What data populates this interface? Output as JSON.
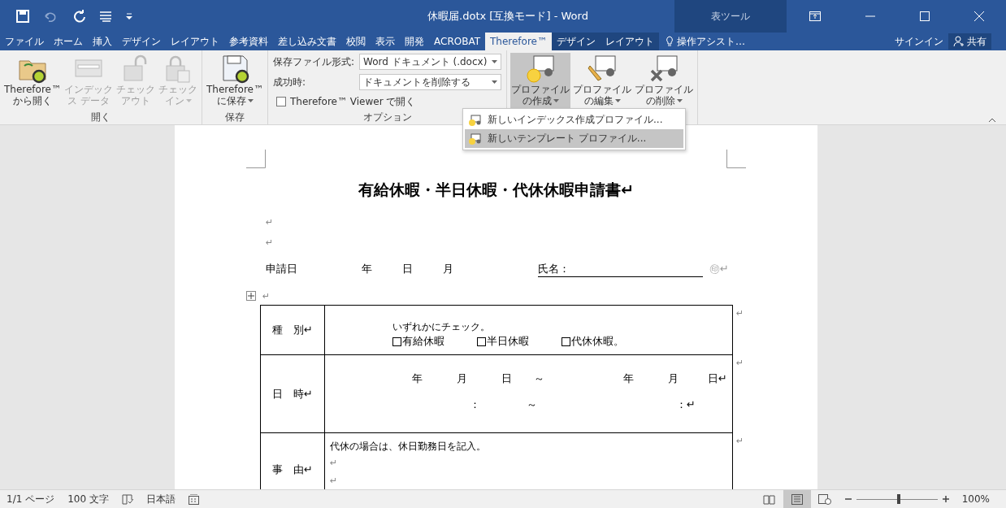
{
  "title_bar": {
    "title": "休暇届.dotx [互換モード] - Word",
    "context_label": "表ツール"
  },
  "tabs": [
    {
      "label": "ファイル",
      "selected": false,
      "kind": "main"
    },
    {
      "label": "ホーム",
      "selected": false,
      "kind": "main"
    },
    {
      "label": "挿入",
      "selected": false,
      "kind": "main"
    },
    {
      "label": "デザイン",
      "selected": false,
      "kind": "main"
    },
    {
      "label": "レイアウト",
      "selected": false,
      "kind": "main"
    },
    {
      "label": "参考資料",
      "selected": false,
      "kind": "main"
    },
    {
      "label": "差し込み文書",
      "selected": false,
      "kind": "main"
    },
    {
      "label": "校閲",
      "selected": false,
      "kind": "main"
    },
    {
      "label": "表示",
      "selected": false,
      "kind": "main"
    },
    {
      "label": "開発",
      "selected": false,
      "kind": "main"
    },
    {
      "label": "ACROBAT",
      "selected": false,
      "kind": "main"
    },
    {
      "label": "Therefore™",
      "selected": true,
      "kind": "main"
    },
    {
      "label": "デザイン",
      "selected": false,
      "kind": "context"
    },
    {
      "label": "レイアウト",
      "selected": false,
      "kind": "context"
    }
  ],
  "tell_me": "操作アシスト…",
  "sign_in": "サインイン",
  "share": "共有",
  "ribbon": {
    "groups": [
      {
        "label": "開く",
        "buttons": [
          {
            "lines": [
              "Therefore™",
              "から開く"
            ],
            "disabled": false,
            "dropdown": false
          },
          {
            "lines": [
              "インデック",
              "ス データ"
            ],
            "disabled": true,
            "dropdown": false
          },
          {
            "lines": [
              "チェック",
              "アウト"
            ],
            "disabled": true,
            "dropdown": false
          },
          {
            "lines": [
              "チェック",
              "イン"
            ],
            "disabled": true,
            "dropdown": true
          }
        ]
      },
      {
        "label": "保存",
        "buttons": [
          {
            "lines": [
              "Therefore™",
              "に保存"
            ],
            "disabled": false,
            "dropdown": true
          }
        ]
      },
      {
        "label": "オプション",
        "options": {
          "format_label": "保存ファイル形式:",
          "format_value": "Word ドキュメント (.docx)",
          "success_label": "成功時:",
          "success_value": "ドキュメントを削除する",
          "viewer_label": "Therefore™ Viewer で開く",
          "viewer_checked": false
        }
      },
      {
        "buttons": [
          {
            "lines": [
              "プロファイル",
              "の作成"
            ],
            "disabled": false,
            "dropdown": true,
            "selected": true
          },
          {
            "lines": [
              "プロファイル",
              "の編集"
            ],
            "disabled": false,
            "dropdown": true,
            "selected": false
          },
          {
            "lines": [
              "プロファイル",
              "の削除"
            ],
            "disabled": false,
            "dropdown": true,
            "selected": false
          }
        ]
      }
    ]
  },
  "menu": {
    "items": [
      {
        "label": "新しいインデックス作成プロファイル...",
        "selected": false
      },
      {
        "label": "新しいテンプレート プロファイル...",
        "selected": true
      }
    ]
  },
  "document": {
    "title": "有給休暇・半日休暇・代休休暇申請書↵",
    "blank_marks": [
      "↵",
      "↵"
    ],
    "apply_line": {
      "label": "申請日",
      "date_parts": [
        "年",
        "日",
        "月"
      ],
      "name_label": "氏名：",
      "seal": "㊞↵"
    },
    "pre_table_mark": "↵",
    "rows": [
      {
        "header": "種　別↵",
        "end_mark": "↵",
        "kind": "check",
        "note": "いずれかにチェック。",
        "options": [
          {
            "label": "有給休暇",
            "checked": false
          },
          {
            "label": "半日休暇",
            "checked": false
          },
          {
            "label": "代休休暇。",
            "checked": false
          }
        ]
      },
      {
        "header": "日　時↵",
        "end_mark": "↵",
        "kind": "datetime",
        "date_parts": [
          "年",
          "月",
          "日",
          "～",
          "年",
          "月",
          "日↵"
        ],
        "time_parts": [
          "：",
          "～",
          "：↵"
        ]
      },
      {
        "header": "事　由↵",
        "end_mark": "↵",
        "kind": "text",
        "note": "代休の場合は、休日勤務日を記入。",
        "marks": [
          "↵",
          "↵"
        ]
      }
    ]
  },
  "status_bar": {
    "page": "1/1 ページ",
    "words": "100 文字",
    "language": "日本語",
    "zoom": "100%",
    "zoom_slider": {
      "level": 0.52
    }
  }
}
